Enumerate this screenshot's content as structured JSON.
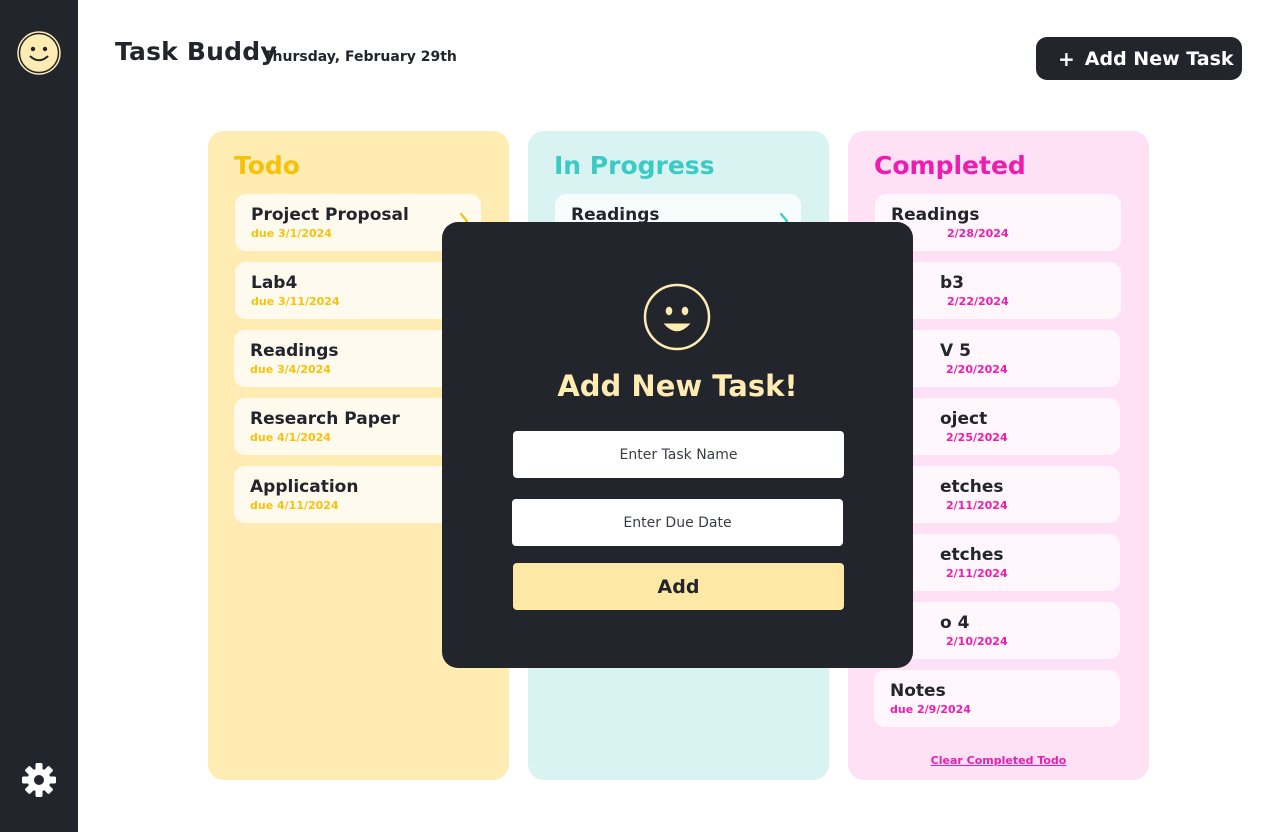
{
  "app": {
    "title": "Task Buddy",
    "date": "Thursday, February 29th",
    "add_button_icon": "+",
    "add_button_label": "Add New Task"
  },
  "sidebar": {
    "logo_icon": "smiley-face-icon",
    "settings_icon": "gear-icon"
  },
  "columns": {
    "todo": {
      "title": "Todo",
      "tasks": [
        {
          "name": "Project Proposal",
          "due": "due 3/1/2024"
        },
        {
          "name": "Lab4",
          "due": "due 3/11/2024"
        },
        {
          "name": "Readings",
          "due": "due 3/4/2024"
        },
        {
          "name": "Research Paper",
          "due": "due 4/1/2024"
        },
        {
          "name": "Application",
          "due": "due 4/11/2024"
        }
      ]
    },
    "in_progress": {
      "title": "In Progress",
      "tasks": [
        {
          "name": "Readings",
          "due": ""
        }
      ]
    },
    "completed": {
      "title": "Completed",
      "tasks": [
        {
          "name": "Readings",
          "due": "2/28/2024"
        },
        {
          "name": "b3",
          "due": "2/22/2024"
        },
        {
          "name": "V 5",
          "due": "2/20/2024"
        },
        {
          "name": "oject",
          "due": "2/25/2024"
        },
        {
          "name": "etches",
          "due": "2/11/2024"
        },
        {
          "name": "etches",
          "due": "2/11/2024"
        },
        {
          "name": "o 4",
          "due": "2/10/2024"
        },
        {
          "name": "Notes",
          "due": "due 2/9/2024"
        }
      ],
      "clear_label": "Clear Completed Todo"
    }
  },
  "modal": {
    "title": "Add New Task!",
    "task_name_placeholder": "Enter Task Name",
    "due_date_placeholder": "Enter Due Date",
    "add_label": "Add"
  },
  "colors": {
    "dark": "#23252d",
    "todo_accent": "#f6c20a",
    "todo_bg": "#ffecb3",
    "progress_accent": "#3ccbc4",
    "progress_bg": "#d8f3f2",
    "completed_accent": "#f01bb1",
    "completed_bg": "#ffe1f5",
    "modal_accent": "#ffecb3"
  }
}
